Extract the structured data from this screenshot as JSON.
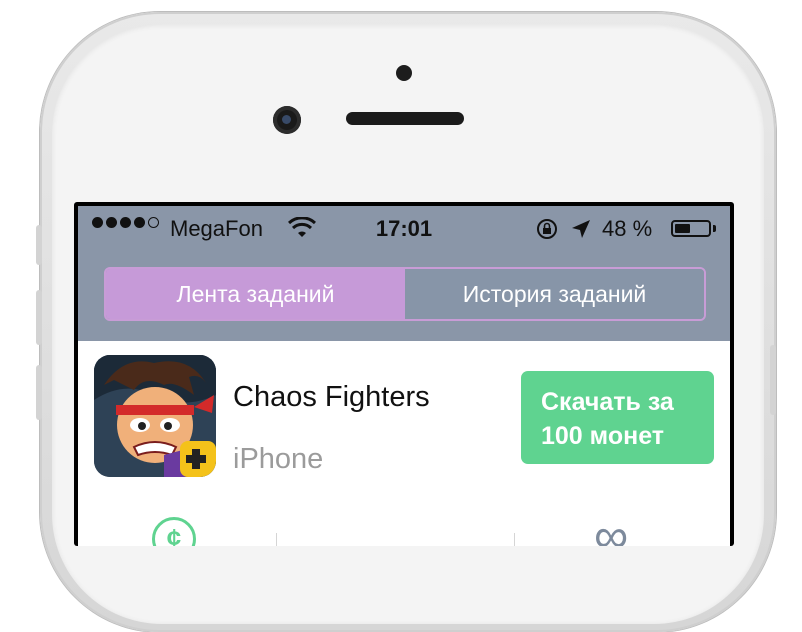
{
  "status_bar": {
    "carrier": "MegaFon",
    "time": "17:01",
    "battery_text": "48 %",
    "battery_level": 0.48,
    "signal_bars_filled": 4,
    "signal_bars_total": 5
  },
  "tabs": [
    {
      "label": "Лента заданий",
      "active": true
    },
    {
      "label": "История заданий",
      "active": false
    }
  ],
  "task": {
    "app_name": "Chaos Fighters",
    "platform": "iPhone",
    "button_label": "Скачать за 100 монет",
    "icon": "game-app-icon"
  },
  "bottom_icons": [
    "coin-icon",
    "infinity-icon"
  ],
  "colors": {
    "nav_background": "#8a96a8",
    "tab_active": "#c69ad8",
    "tab_border": "#c89cd6",
    "button_green": "#5fd390",
    "platform_gray": "#9b9b9b"
  }
}
